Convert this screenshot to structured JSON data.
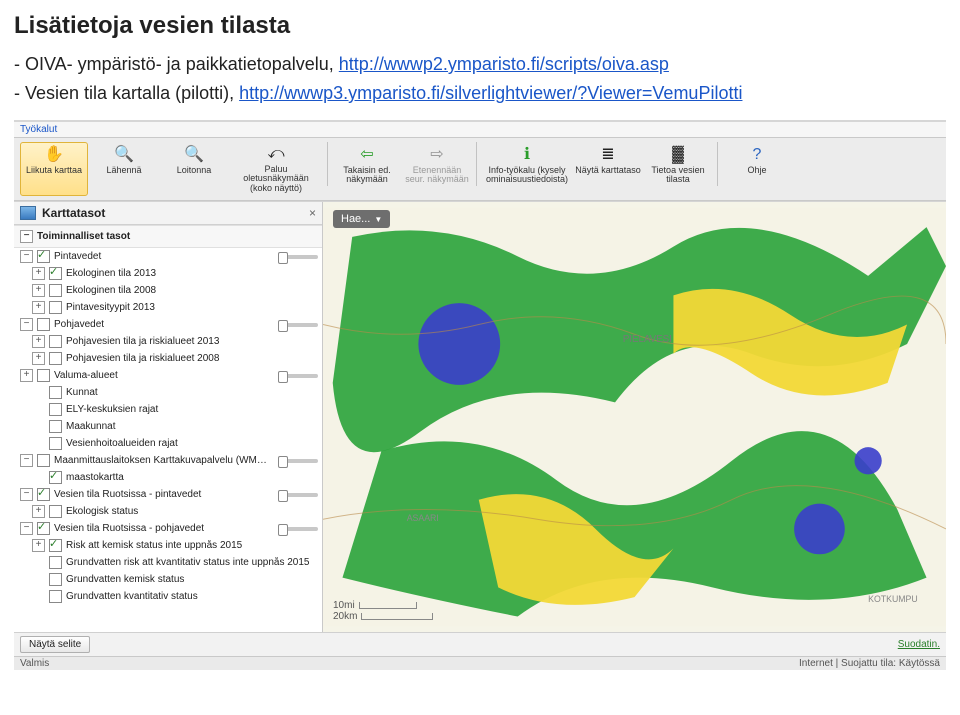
{
  "heading": "Lisätietoja vesien tilasta",
  "bullets": [
    {
      "prefix": "- OIVA- ympäristö- ja paikkatietopalvelu, ",
      "link": "http://wwwp2.ymparisto.fi/scripts/oiva.asp"
    },
    {
      "prefix": "- Vesien tila kartalla (pilotti), ",
      "link": "http://wwwp3.ymparisto.fi/silverlightviewer/?Viewer=VemuPilotti"
    }
  ],
  "toolbar": {
    "tyokalut_tab": "Työkalut",
    "items": [
      {
        "icon": "✋",
        "label": "Liikuta karttaa",
        "active": true
      },
      {
        "icon": "🔍",
        "label": "Lähennä"
      },
      {
        "icon": "🔍",
        "label": "Loitonna"
      },
      {
        "icon": "⤺",
        "label": "Paluu oletusnäkymään (koko näyttö)"
      },
      {
        "icon": "⇦",
        "label": "Takaisin ed. näkymään"
      },
      {
        "icon": "⇨",
        "label": "Etenennään seur. näkymään",
        "disabled": true
      },
      {
        "icon": "ℹ",
        "label": "Info-työkalu (kysely ominaisuustiedoista)"
      },
      {
        "icon": "≣",
        "label": "Näytä karttataso"
      },
      {
        "icon": "▓",
        "label": "Tietoa vesien tilasta"
      },
      {
        "icon": "?",
        "label": "Ohje"
      }
    ]
  },
  "side": {
    "title": "Karttatasot",
    "section": "Toiminnalliset tasot",
    "layers": [
      {
        "exp": "-",
        "chk": true,
        "txt": "Pintavedet",
        "ind": 0,
        "slider": true
      },
      {
        "exp": "+",
        "chk": true,
        "txt": "Ekologinen tila 2013",
        "ind": 1
      },
      {
        "exp": "+",
        "chk": false,
        "txt": "Ekologinen tila 2008",
        "ind": 1
      },
      {
        "exp": "+",
        "chk": false,
        "txt": "Pintavesityypit 2013",
        "ind": 1
      },
      {
        "exp": "-",
        "chk": false,
        "txt": "Pohjavedet",
        "ind": 0,
        "slider": true
      },
      {
        "exp": "+",
        "chk": false,
        "txt": "Pohjavesien tila ja riskialueet 2013",
        "ind": 1
      },
      {
        "exp": "+",
        "chk": false,
        "txt": "Pohjavesien tila ja riskialueet 2008",
        "ind": 1
      },
      {
        "exp": "+",
        "chk": false,
        "txt": "Valuma-alueet",
        "ind": 0,
        "slider": true
      },
      {
        "exp": "",
        "chk": false,
        "txt": "Kunnat",
        "ind": 1
      },
      {
        "exp": "",
        "chk": false,
        "txt": "ELY-keskuksien rajat",
        "ind": 1
      },
      {
        "exp": "",
        "chk": false,
        "txt": "Maakunnat",
        "ind": 1
      },
      {
        "exp": "",
        "chk": false,
        "txt": "Vesienhoitoalueiden rajat",
        "ind": 1
      },
      {
        "exp": "-",
        "chk": false,
        "txt": "Maanmittauslaitoksen Karttakuvapalvelu (WMTS)",
        "ind": 0,
        "slider": true
      },
      {
        "exp": "",
        "chk": true,
        "txt": "maastokartta",
        "ind": 1
      },
      {
        "exp": "-",
        "chk": true,
        "txt": "Vesien tila Ruotsissa - pintavedet",
        "ind": 0,
        "slider": true
      },
      {
        "exp": "+",
        "chk": false,
        "txt": "Ekologisk status",
        "ind": 1
      },
      {
        "exp": "-",
        "chk": true,
        "txt": "Vesien tila Ruotsissa - pohjavedet",
        "ind": 0,
        "slider": true
      },
      {
        "exp": "+",
        "chk": true,
        "txt": "Risk att kemisk status inte uppnås 2015",
        "ind": 1
      },
      {
        "exp": "",
        "chk": false,
        "txt": "Grundvatten risk att kvantitativ status inte uppnås 2015",
        "ind": 1
      },
      {
        "exp": "",
        "chk": false,
        "txt": "Grundvatten kemisk status",
        "ind": 1
      },
      {
        "exp": "",
        "chk": false,
        "txt": "Grundvatten kvantitativ status",
        "ind": 1
      }
    ]
  },
  "map": {
    "search": "Hae...",
    "scale_top": "10mi",
    "scale_bot": "20km",
    "label1": "PIELAVESI",
    "label2": "KOTKUMPU",
    "label3": "ASAARI"
  },
  "footer": {
    "show_legend": "Näytä selite",
    "filter": "Suodatin."
  },
  "status": {
    "ready": "Valmis",
    "zone": "Internet | Suojattu tila: Käytössä"
  }
}
